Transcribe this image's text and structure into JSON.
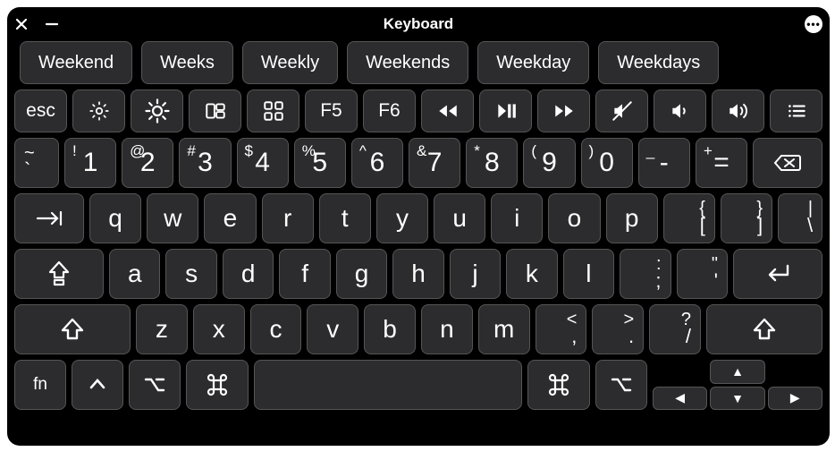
{
  "window": {
    "title": "Keyboard"
  },
  "suggestions": [
    "Weekend",
    "Weeks",
    "Weekly",
    "Weekends",
    "Weekday",
    "Weekdays"
  ],
  "fn_row": {
    "esc": "esc",
    "f5": "F5",
    "f6": "F6"
  },
  "number_row": [
    {
      "upper": "~",
      "lower": "`"
    },
    {
      "upper": "!",
      "lower": "1"
    },
    {
      "upper": "@",
      "lower": "2"
    },
    {
      "upper": "#",
      "lower": "3"
    },
    {
      "upper": "$",
      "lower": "4"
    },
    {
      "upper": "%",
      "lower": "5"
    },
    {
      "upper": "^",
      "lower": "6"
    },
    {
      "upper": "&",
      "lower": "7"
    },
    {
      "upper": "*",
      "lower": "8"
    },
    {
      "upper": "(",
      "lower": "9"
    },
    {
      "upper": ")",
      "lower": "0"
    },
    {
      "upper": "_",
      "lower": "-"
    },
    {
      "upper": "+",
      "lower": "="
    }
  ],
  "qwerty_row": [
    "q",
    "w",
    "e",
    "r",
    "t",
    "y",
    "u",
    "i",
    "o",
    "p"
  ],
  "qwerty_tail": [
    {
      "upper": "{",
      "lower": "["
    },
    {
      "upper": "}",
      "lower": "]"
    },
    {
      "upper": "|",
      "lower": "\\"
    }
  ],
  "asdf_row": [
    "a",
    "s",
    "d",
    "f",
    "g",
    "h",
    "j",
    "k",
    "l"
  ],
  "asdf_tail": [
    {
      "upper": ":",
      "lower": ";"
    },
    {
      "upper": "\"",
      "lower": "'"
    }
  ],
  "zxcv_row": [
    "z",
    "x",
    "c",
    "v",
    "b",
    "n",
    "m"
  ],
  "zxcv_tail": [
    {
      "upper": "<",
      "lower": ","
    },
    {
      "upper": ">",
      "lower": "."
    },
    {
      "upper": "?",
      "lower": "/"
    }
  ],
  "bottom": {
    "fn": "fn"
  }
}
